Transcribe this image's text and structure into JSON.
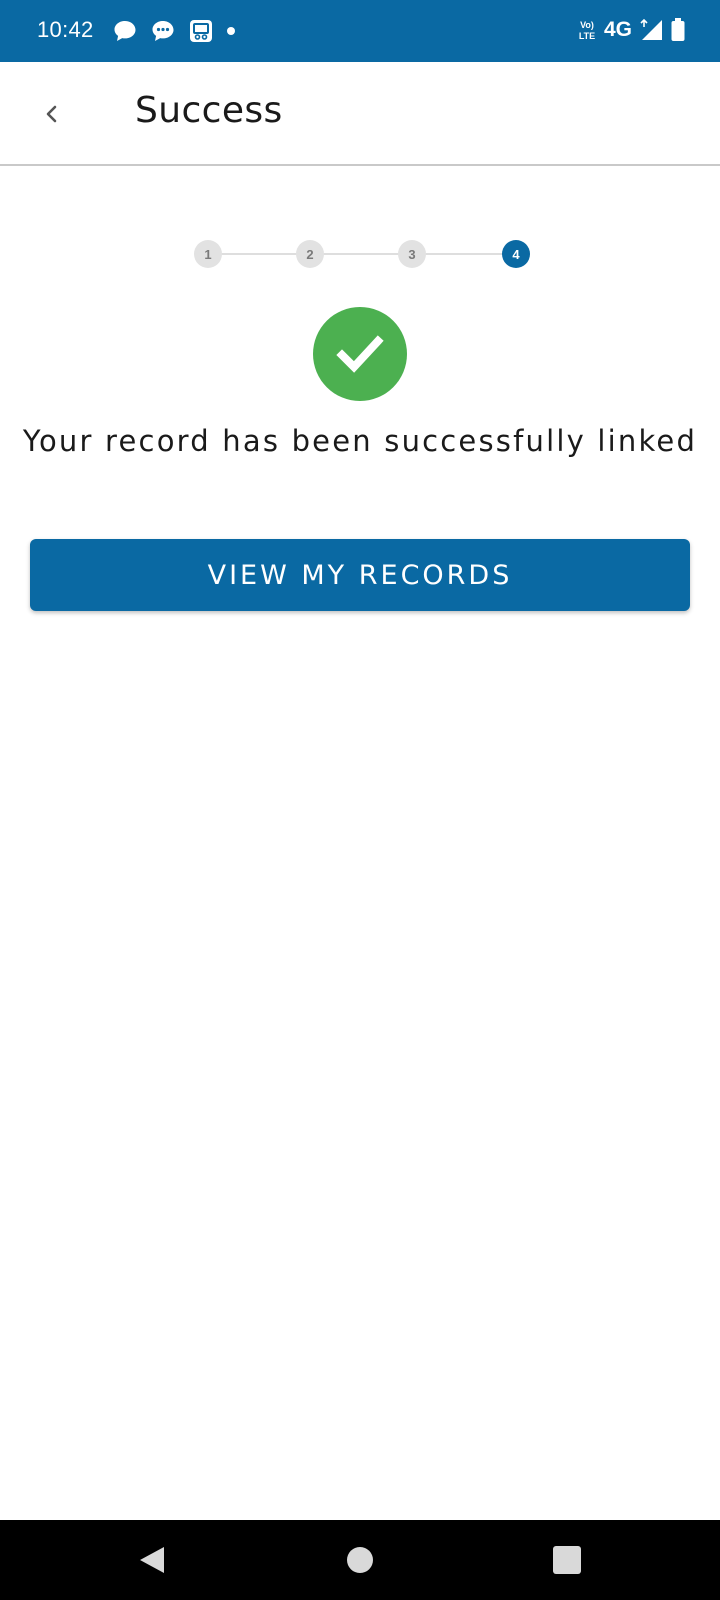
{
  "status_bar": {
    "time": "10:42",
    "network": "4G",
    "icons_left": [
      "chat-bubble-icon",
      "message-dots-icon",
      "screen-share-icon",
      "notification-dot-icon"
    ],
    "icons_right": [
      "volte-icon",
      "network-arrows-icon",
      "signal-icon",
      "battery-icon"
    ]
  },
  "app_bar": {
    "title": "Success",
    "back_icon": "chevron-left-icon"
  },
  "stepper": {
    "steps": [
      "1",
      "2",
      "3",
      "4"
    ],
    "active_step": 4
  },
  "success": {
    "icon": "check-circle-icon",
    "message": "Your record has been successfully linked"
  },
  "actions": {
    "view_records_label": "VIEW MY RECORDS"
  },
  "nav_bar": {
    "icons": [
      "back-triangle-icon",
      "home-circle-icon",
      "recents-square-icon"
    ]
  },
  "colors": {
    "primary": "#0a69a3",
    "success": "#4cb050",
    "inactive_step": "#e2e2e2"
  }
}
